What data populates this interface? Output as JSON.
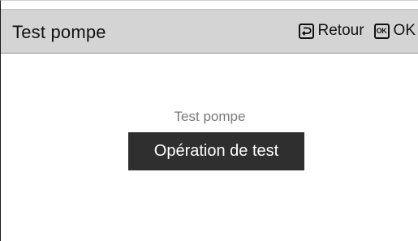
{
  "header": {
    "title": "Test pompe",
    "back": {
      "icon": "return-arrow-icon",
      "label": "Retour"
    },
    "ok": {
      "icon_text": "OK",
      "label": "OK"
    }
  },
  "main": {
    "subtitle": "Test pompe",
    "operation_button_label": "Opération de test"
  },
  "colors": {
    "header_bg": "#d4d4d4",
    "button_bg": "#2f2f2f",
    "subtitle_text": "#7a7a7a"
  }
}
